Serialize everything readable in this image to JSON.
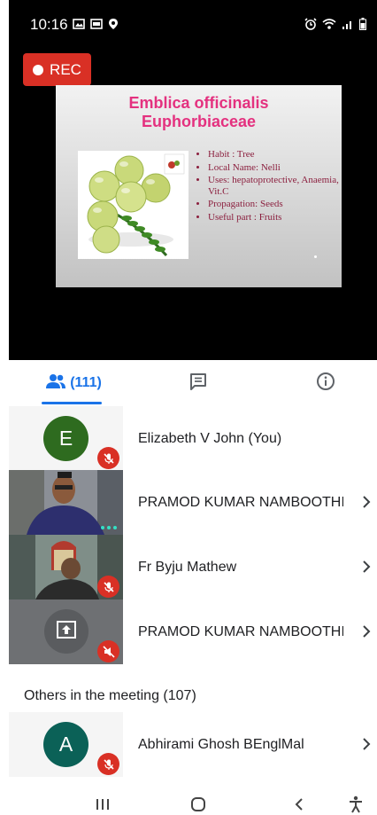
{
  "status_bar": {
    "time": "10:16",
    "left_icons": [
      "gallery-icon",
      "photo-icon",
      "location-icon"
    ],
    "right_icons": [
      "alarm-icon",
      "wifi-icon",
      "signal-icon",
      "battery-icon"
    ]
  },
  "recording": {
    "label": "REC",
    "color": "#d93025"
  },
  "slide": {
    "title_line1": "Emblica officinalis",
    "title_line2": "Euphorbiaceae",
    "title_color": "#e4317f",
    "bullets": [
      "Habit : Tree",
      "Local Name:  Nelli",
      "Uses: hepatoprotective, Anaemia, Vit.C",
      "Propagation: Seeds",
      "Useful part : Fruits"
    ]
  },
  "tabs": {
    "people_count": "(111)",
    "active": "people",
    "accent": "#1a73e8",
    "icons": [
      "people-icon",
      "chat-icon",
      "info-icon"
    ]
  },
  "participants": [
    {
      "name": "Elizabeth V John (You)",
      "avatar_letter": "E",
      "avatar_color": "#2e6b1f",
      "muted": true
    },
    {
      "name": "PRAMOD KUMAR NAMBOOTHI...",
      "video": true,
      "speaking": true
    },
    {
      "name": "Fr Byju Mathew",
      "video": true,
      "muted": true
    },
    {
      "name": "PRAMOD KUMAR NAMBOOTHI...",
      "presenting": true,
      "volume_muted": true
    }
  ],
  "others_section": {
    "title": "Others in the meeting (107)"
  },
  "others": [
    {
      "name": "Abhirami Ghosh BEnglMal",
      "avatar_letter": "A",
      "avatar_color": "#0b6157",
      "muted": true
    }
  ],
  "navbar": {
    "icons": [
      "recent-apps-icon",
      "home-icon",
      "back-icon",
      "accessibility-icon"
    ]
  }
}
